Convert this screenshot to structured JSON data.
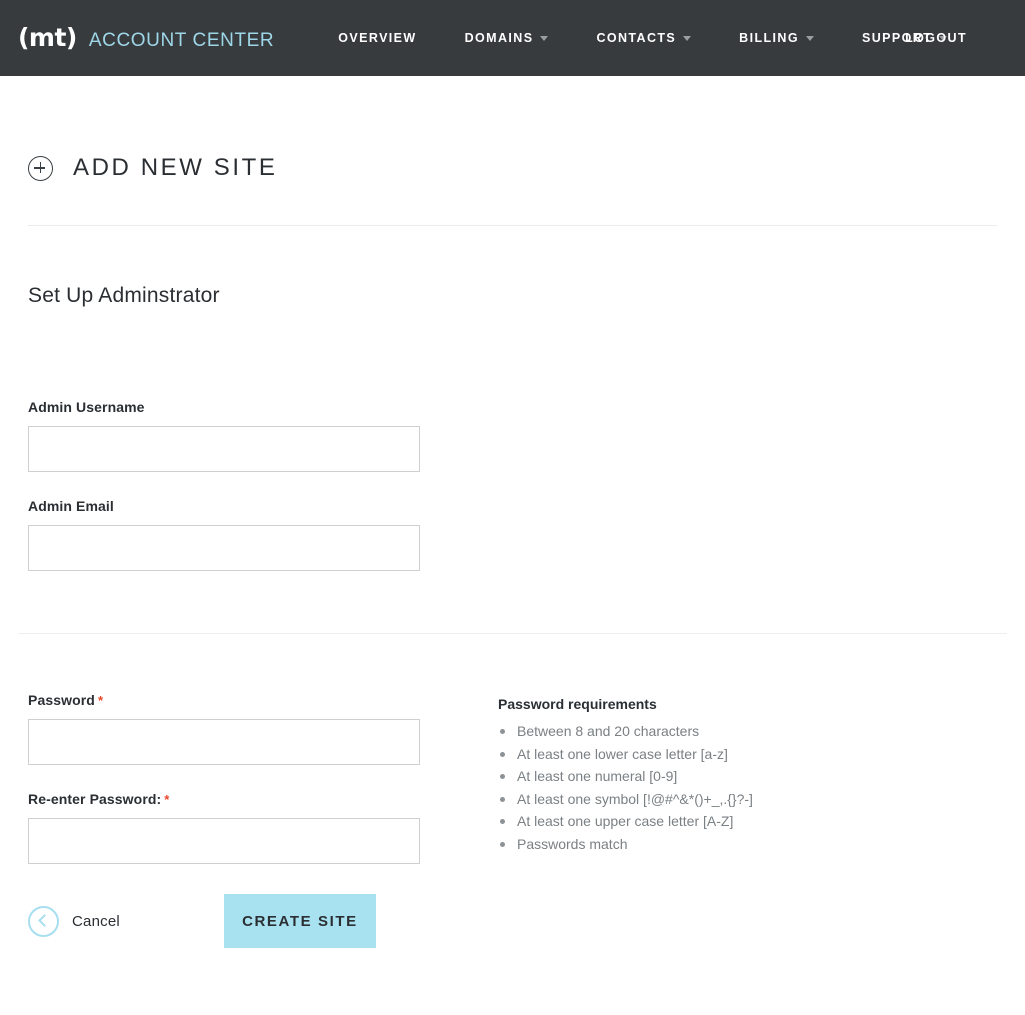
{
  "header": {
    "logo_text": "(mt)",
    "brand": "ACCOUNT CENTER",
    "nav": [
      {
        "label": "OVERVIEW",
        "has_caret": false
      },
      {
        "label": "DOMAINS",
        "has_caret": true
      },
      {
        "label": "CONTACTS",
        "has_caret": true
      },
      {
        "label": "BILLING",
        "has_caret": true
      },
      {
        "label": "SUPPORT",
        "has_caret": true
      }
    ],
    "logout": "LOGOUT",
    "bg_color": "#373b3e",
    "brand_color": "#9ed7e8"
  },
  "page": {
    "title": "ADD NEW SITE",
    "section_heading": "Set Up Adminstrator"
  },
  "form": {
    "username": {
      "label": "Admin Username",
      "value": "",
      "placeholder": ""
    },
    "email": {
      "label": "Admin Email",
      "value": "",
      "placeholder": ""
    },
    "password": {
      "label": "Password",
      "required_mark": "*",
      "value": "",
      "placeholder": ""
    },
    "password_confirm": {
      "label": "Re-enter Password:",
      "required_mark": "*",
      "value": "",
      "placeholder": ""
    }
  },
  "password_requirements": {
    "title": "Password requirements",
    "items": [
      "Between 8 and 20 characters",
      "At least one lower case letter [a-z]",
      "At least one numeral [0-9]",
      "At least one symbol [!@#^&*()+_,.{}?-]",
      "At least one upper case letter [A-Z]",
      "Passwords match"
    ]
  },
  "actions": {
    "cancel_label": "Cancel",
    "create_label": "CREATE SITE",
    "accent_color": "#a8e2f0"
  }
}
